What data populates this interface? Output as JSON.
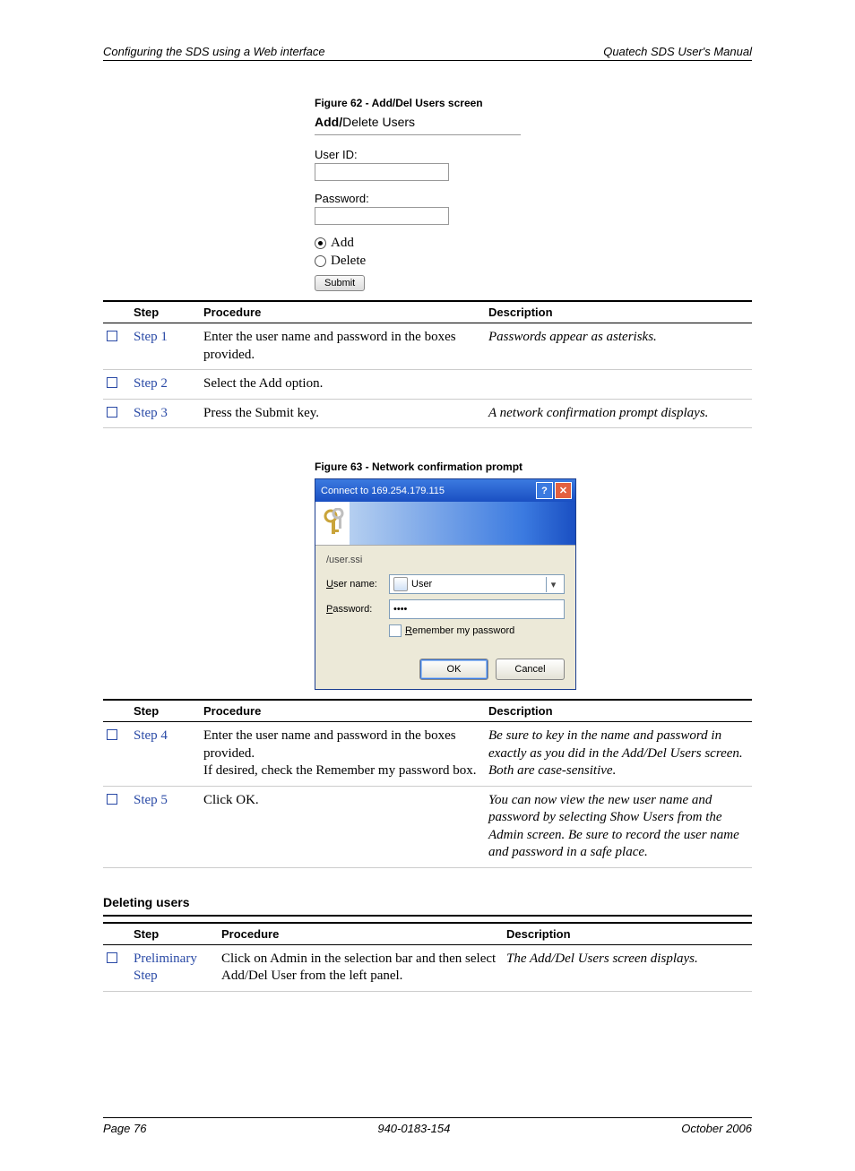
{
  "header": {
    "left": "Configuring the SDS using a Web interface",
    "right": "Quatech SDS User's Manual"
  },
  "figure62": {
    "caption": "Figure 62 - Add/Del Users screen",
    "title_bold": "Add/",
    "title_rest": "Delete Users",
    "user_id_label": "User ID:",
    "password_label": "Password:",
    "radio_add": "Add",
    "radio_delete": "Delete",
    "submit": "Submit"
  },
  "table1": {
    "headers": {
      "step": "Step",
      "procedure": "Procedure",
      "description": "Description"
    },
    "rows": [
      {
        "step": "Step 1",
        "procedure": "Enter the user name and password in the boxes provided.",
        "description": "Passwords appear as asterisks."
      },
      {
        "step": "Step 2",
        "procedure": "Select the Add option.",
        "description": ""
      },
      {
        "step": "Step 3",
        "procedure": "Press the Submit key.",
        "description": "A network confirmation prompt displays."
      }
    ]
  },
  "figure63": {
    "caption": "Figure 63 - Network confirmation prompt",
    "title": "Connect to 169.254.179.115",
    "server": "/user.ssi",
    "username_label_pre": "U",
    "username_label_post": "ser name:",
    "password_label_pre": "P",
    "password_label_post": "assword:",
    "user_value": "User",
    "password_value": "••••",
    "remember_pre": "R",
    "remember_post": "emember my password",
    "ok": "OK",
    "cancel": "Cancel"
  },
  "table2": {
    "headers": {
      "step": "Step",
      "procedure": "Procedure",
      "description": "Description"
    },
    "rows": [
      {
        "step": "Step 4",
        "procedure": "Enter the user name and password in the boxes provided.\nIf desired, check the Remember my password box.",
        "description": "Be sure to key in the name and password in exactly as you did in the Add/Del Users screen. Both are case-sensitive."
      },
      {
        "step": "Step 5",
        "procedure": "Click OK.",
        "description": "You can now view the new user name and password by selecting Show Users from the Admin screen. Be sure to record the user name and password in a safe place."
      }
    ]
  },
  "deleting": {
    "heading": "Deleting users",
    "headers": {
      "step": "Step",
      "procedure": "Procedure",
      "description": "Description"
    },
    "rows": [
      {
        "step": "Preliminary Step",
        "procedure": "Click on Admin in the selection bar and then select Add/Del User from the left panel.",
        "description": "The Add/Del Users screen displays."
      }
    ]
  },
  "footer": {
    "left": "Page 76",
    "center": "940-0183-154",
    "right": "October 2006"
  }
}
